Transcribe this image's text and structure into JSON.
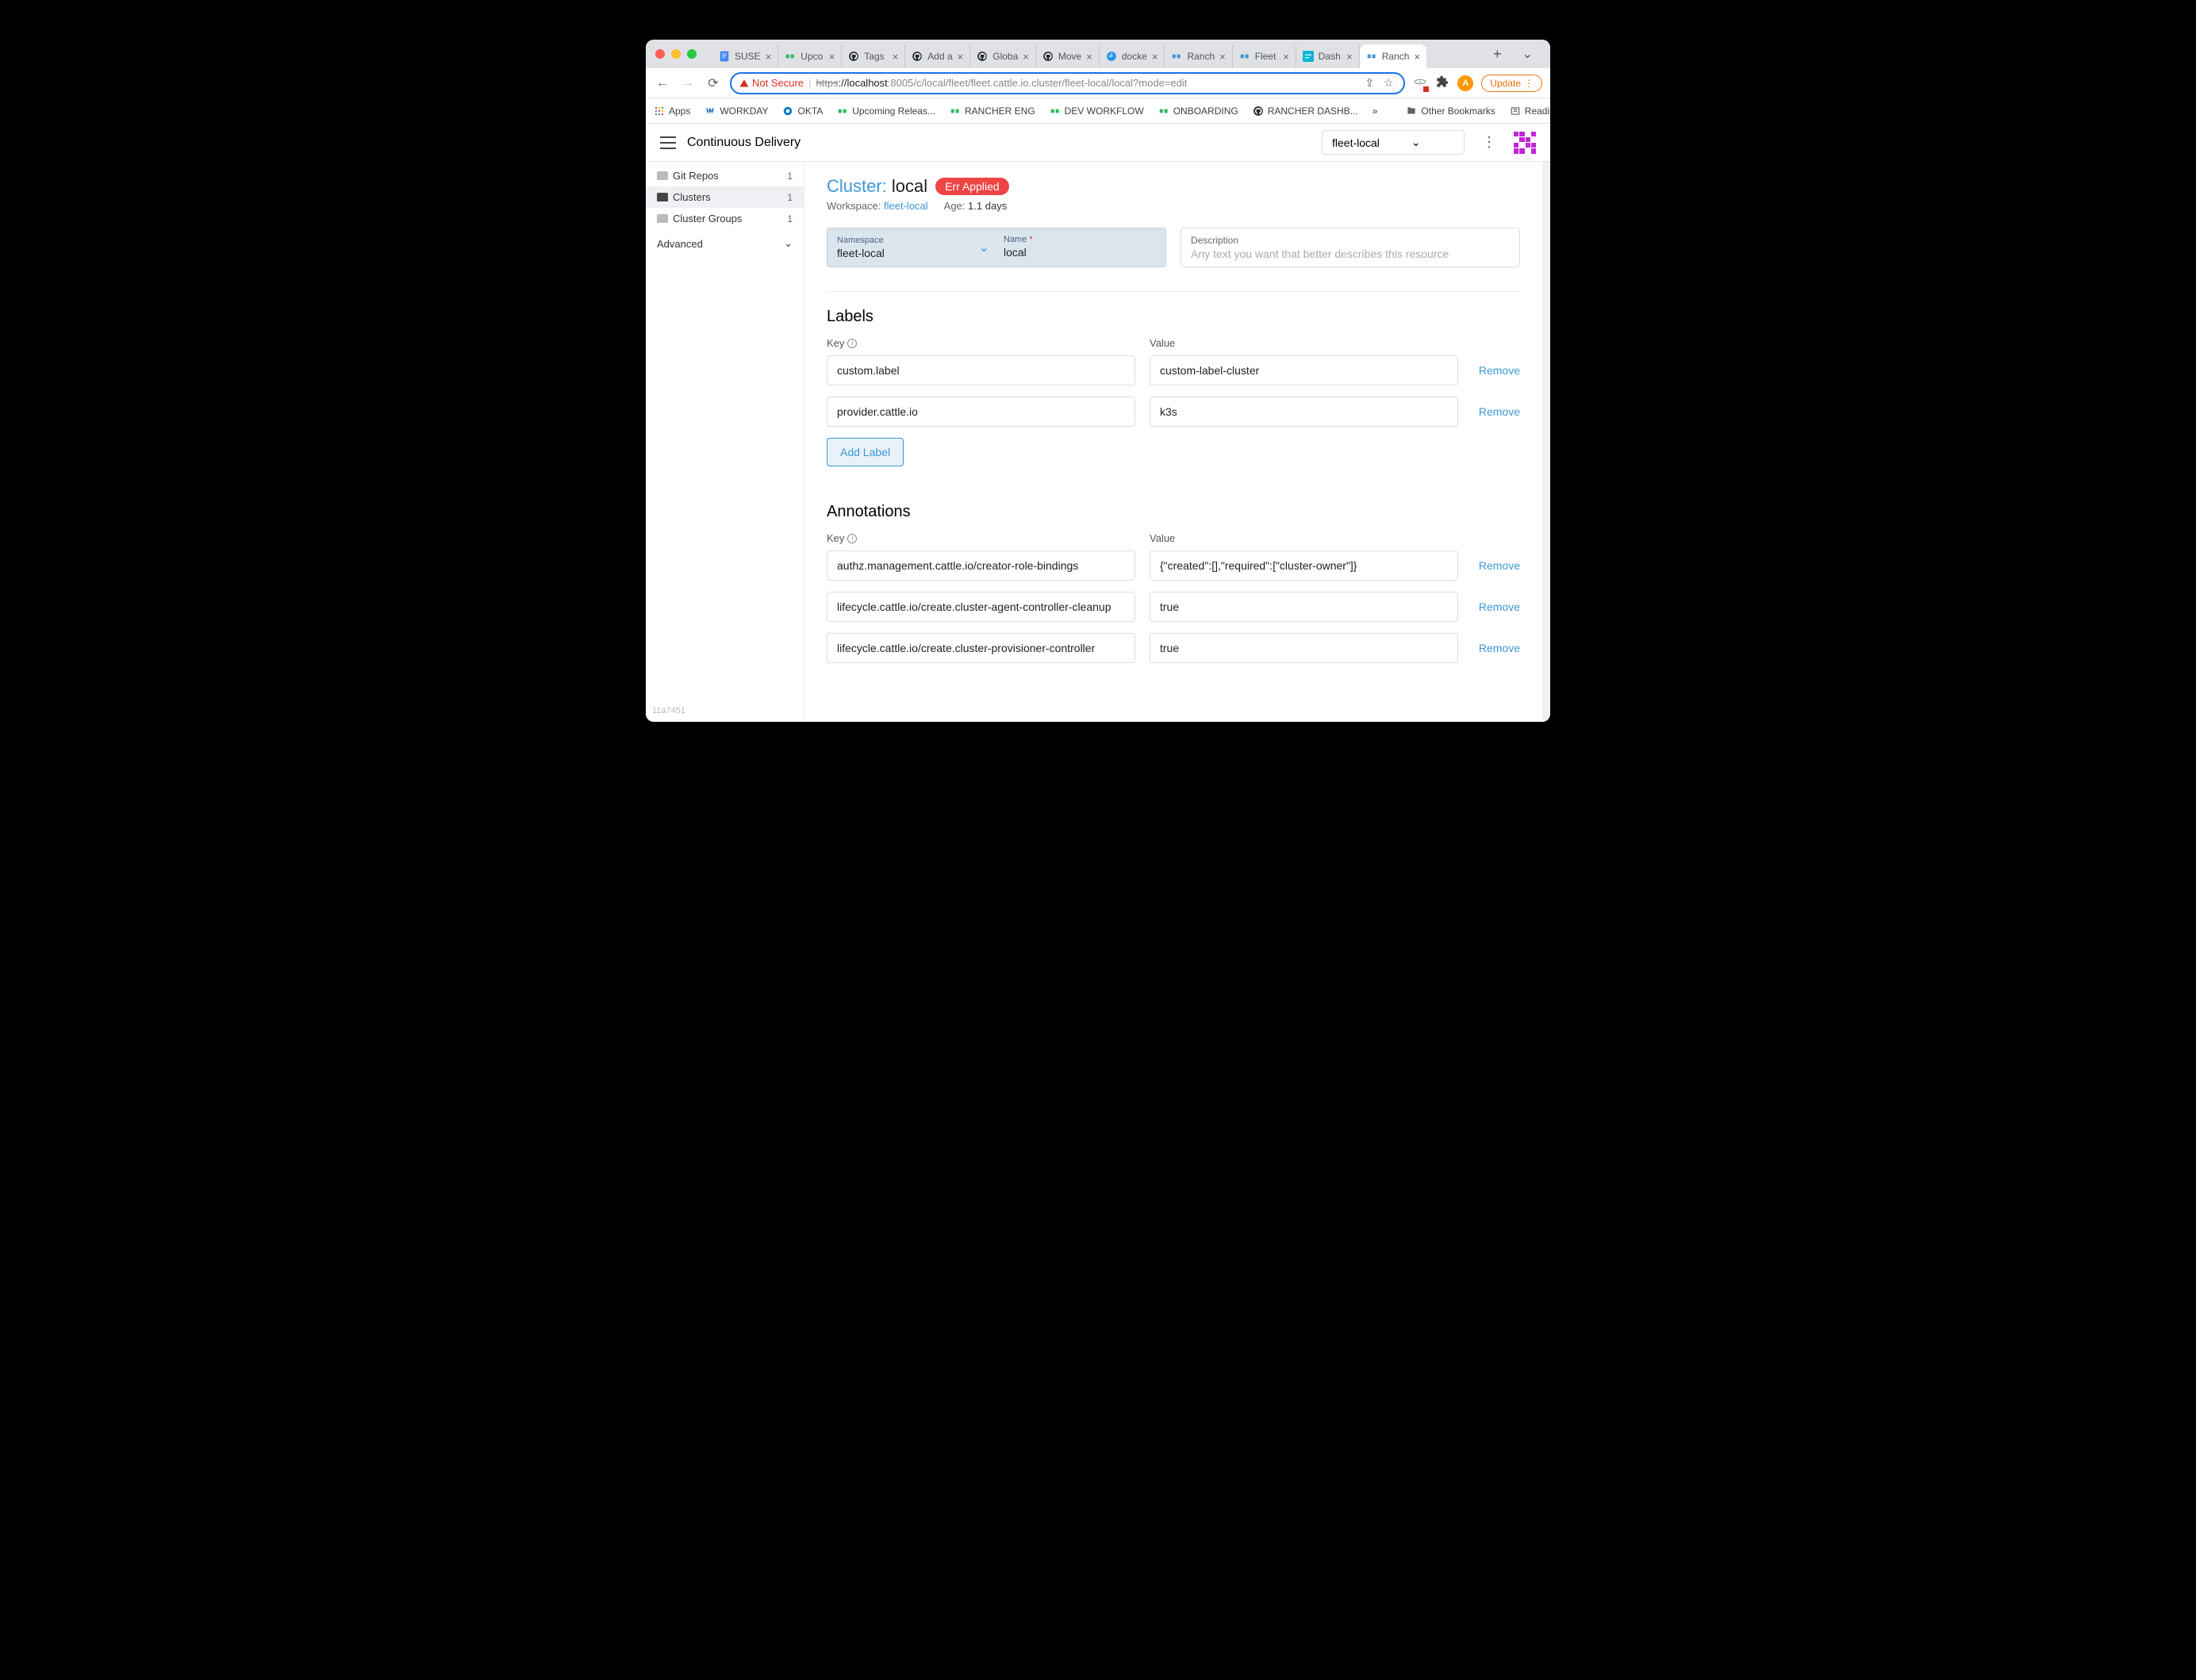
{
  "browser": {
    "tabs": [
      {
        "title": "SUSE",
        "icon": "gdoc"
      },
      {
        "title": "Upco",
        "icon": "rancher-green"
      },
      {
        "title": "Tags",
        "icon": "github"
      },
      {
        "title": "Add a",
        "icon": "github"
      },
      {
        "title": "Globa",
        "icon": "github"
      },
      {
        "title": "Move",
        "icon": "github"
      },
      {
        "title": "docke",
        "icon": "docker"
      },
      {
        "title": "Ranch",
        "icon": "rancher-blue"
      },
      {
        "title": "Fleet",
        "icon": "rancher-blue"
      },
      {
        "title": "Dash",
        "icon": "dash"
      },
      {
        "title": "Ranch",
        "icon": "rancher-blue",
        "active": true
      }
    ],
    "not_secure_label": "Not Secure",
    "url_struck": "https",
    "url_host": "://localhost",
    "url_path": ":8005/c/local/fleet/fleet.cattle.io.cluster/fleet-local/local?mode=edit",
    "avatar_letter": "A",
    "update_label": "Update",
    "bookmarks": [
      {
        "label": "Apps",
        "icon": "apps"
      },
      {
        "label": "WORKDAY",
        "icon": "workday"
      },
      {
        "label": "OKTA",
        "icon": "okta"
      },
      {
        "label": "Upcoming Releas...",
        "icon": "rancher-green"
      },
      {
        "label": "RANCHER ENG",
        "icon": "rancher-green"
      },
      {
        "label": "DEV WORKFLOW",
        "icon": "rancher-green"
      },
      {
        "label": "ONBOARDING",
        "icon": "rancher-green"
      },
      {
        "label": "RANCHER DASHB...",
        "icon": "github"
      }
    ],
    "overflow_label": "»",
    "other_bookmarks": "Other Bookmarks",
    "reading_list": "Reading List"
  },
  "app": {
    "title": "Continuous Delivery",
    "namespace_selector": "fleet-local",
    "sidebar": {
      "items": [
        {
          "label": "Git Repos",
          "count": "1",
          "active": false,
          "solid": false
        },
        {
          "label": "Clusters",
          "count": "1",
          "active": true,
          "solid": true
        },
        {
          "label": "Cluster Groups",
          "count": "1",
          "active": false,
          "solid": false
        }
      ],
      "advanced_label": "Advanced"
    }
  },
  "page": {
    "crumb": "Cluster:",
    "name": "local",
    "status": "Err Applied",
    "workspace_label": "Workspace:",
    "workspace_value": "fleet-local",
    "age_label": "Age:",
    "age_value": "1.1 days",
    "namespace": {
      "label": "Namespace",
      "value": "fleet-local"
    },
    "name_field": {
      "label": "Name",
      "value": "local"
    },
    "description": {
      "label": "Description",
      "placeholder": "Any text you want that better describes this resource"
    },
    "labels": {
      "title": "Labels",
      "key_header": "Key",
      "value_header": "Value",
      "rows": [
        {
          "key": "custom.label",
          "value": "custom-label-cluster"
        },
        {
          "key": "provider.cattle.io",
          "value": "k3s"
        }
      ],
      "add_label": "Add Label",
      "remove_label": "Remove"
    },
    "annotations": {
      "title": "Annotations",
      "key_header": "Key",
      "value_header": "Value",
      "rows": [
        {
          "key": "authz.management.cattle.io/creator-role-bindings",
          "value": "{\"created\":[],\"required\":[\"cluster-owner\"]}"
        },
        {
          "key": "lifecycle.cattle.io/create.cluster-agent-controller-cleanup",
          "value": "true"
        },
        {
          "key": "lifecycle.cattle.io/create.cluster-provisioner-controller",
          "value": "true"
        }
      ],
      "remove_label": "Remove"
    },
    "build_hash": "11a7451"
  }
}
